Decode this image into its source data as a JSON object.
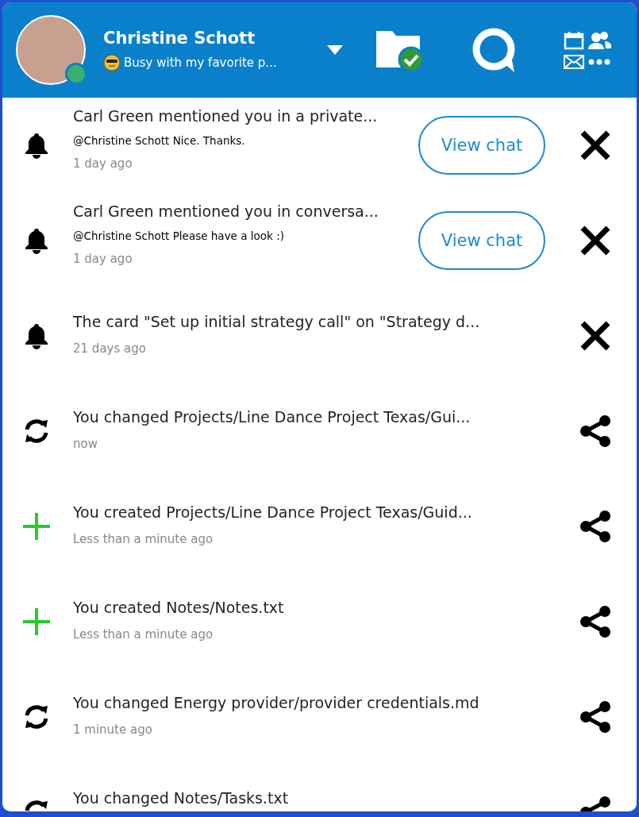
{
  "header": {
    "name": "Christine Schott",
    "status_text": "Busy with my favorite p...",
    "online": true
  },
  "notifications": [
    {
      "kind": "mention",
      "title": "Carl Green mentioned you in a private...",
      "message": "@Christine Schott Nice. Thanks.",
      "time": "1 day ago",
      "button": "View chat"
    },
    {
      "kind": "mention",
      "title": "Carl Green mentioned you in conversa...",
      "message": "@Christine Schott Please have a look :)",
      "time": "1 day ago",
      "button": "View chat"
    },
    {
      "kind": "notice",
      "title": "The card \"Set up initial strategy call\" on \"Strategy d...",
      "time": "21 days ago"
    },
    {
      "kind": "changed",
      "title": "You changed Projects/Line Dance Project Texas/Gui...",
      "time": "now"
    },
    {
      "kind": "created",
      "title": "You created Projects/Line Dance Project Texas/Guid...",
      "time": "Less than a minute ago"
    },
    {
      "kind": "created",
      "title": "You created Notes/Notes.txt",
      "time": "Less than a minute ago"
    },
    {
      "kind": "changed",
      "title": "You changed Energy provider/provider credentials.md",
      "time": "1 minute ago"
    },
    {
      "kind": "changed",
      "title": "You changed Notes/Tasks.txt"
    }
  ]
}
